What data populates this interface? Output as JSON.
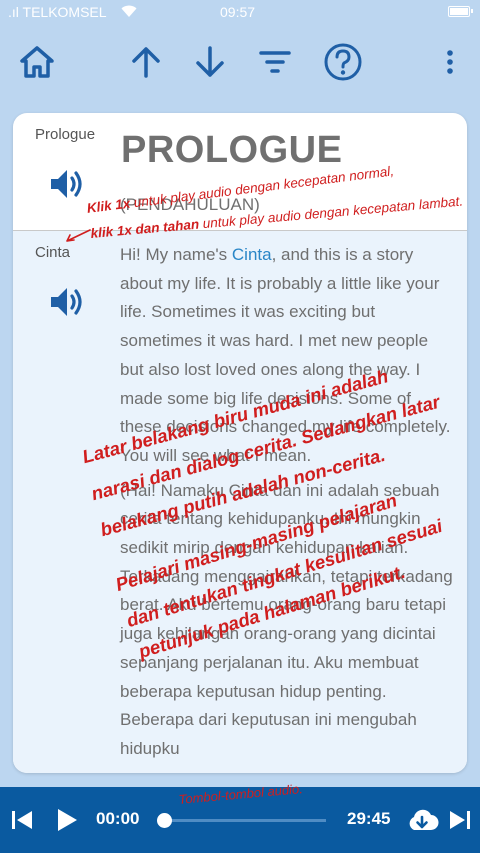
{
  "status_bar": {
    "carrier": ".ıl TELKOMSEL",
    "time": "09:57"
  },
  "toolbar": {
    "icons": [
      "home-icon",
      "arrow-up-icon",
      "arrow-down-icon",
      "filter-icon",
      "help-icon",
      "more-vert-icon"
    ],
    "accent_color": "#1f5fa6"
  },
  "card": {
    "speakers": [
      {
        "name": "Prologue"
      },
      {
        "name": "Cinta"
      }
    ],
    "title": "PROLOGUE",
    "subtitle": "(PENDAHULUAN)",
    "story_en_before_name": "Hi! My name's ",
    "story_name": "Cinta",
    "story_en_after_name": ", and this is a story about my life. It is probably a little like your life. Sometimes it was exciting but sometimes it was hard. I met new people but also lost loved ones along the way. I made some big life decisions. Some of these decisions changed my life completely. You will see what I mean.",
    "story_id": "(Hai! Namaku Cinta dan ini adalah sebuah cerita tentang kehidupanku. Ini mungkin sedikit mirip dengan kehidupan kalian. Terkadang menggairahkan, tetapi terkadang berat. Aku bertemu orang-orang baru tetapi juga kehilangan orang-orang yang dicintai sepanjang perjalanan itu. Aku membuat beberapa keputusan hidup penting. Beberapa dari keputusan ini mengubah hidupku"
  },
  "annotations": {
    "audio_tip": {
      "line1_bold": "Klik 1x",
      "line1_rest": " untuk play audio dengan kecepatan normal,",
      "line2_bold": "klik 1x dan tahan",
      "line2_rest": " untuk play audio dengan kecepatan lambat."
    },
    "background_note": [
      "Latar belakang biru muda ini adalah",
      "narasi dan dialog cerita. Sedangkan latar",
      "belakang putih adalah non-cerita."
    ],
    "study_note": [
      "Pelajari masing-masing pelajaran",
      "dan tentukan tingkat kesulitan sesuai",
      "petunjuk pada halaman berikut."
    ],
    "player_note": "Tombol-tombol audio.",
    "color": "#d01e1e"
  },
  "player": {
    "current_time": "00:00",
    "total_time": "29:45",
    "progress": 0,
    "icons": [
      "skip-previous-icon",
      "play-icon",
      "download-icon",
      "skip-next-icon"
    ],
    "background": "#0a5aa0"
  }
}
